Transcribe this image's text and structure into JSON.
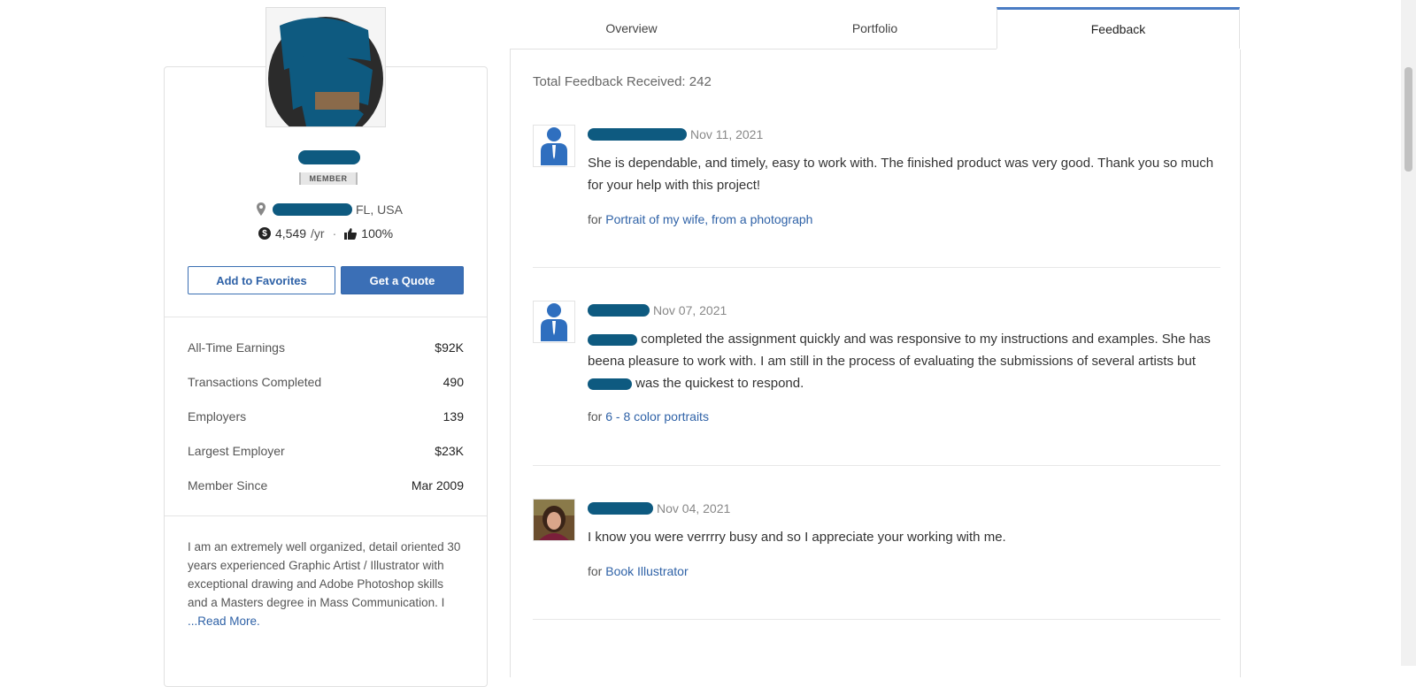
{
  "profile": {
    "badge": "MEMBER",
    "location_suffix": "FL, USA",
    "rate": "4,549",
    "rate_unit": "/yr",
    "approval": "100%",
    "add_favorites": "Add to Favorites",
    "get_quote": "Get a Quote",
    "stats": [
      {
        "label": "All-Time Earnings",
        "value": "$92K"
      },
      {
        "label": "Transactions Completed",
        "value": "490"
      },
      {
        "label": "Employers",
        "value": "139"
      },
      {
        "label": "Largest Employer",
        "value": "$23K"
      },
      {
        "label": "Member Since",
        "value": "Mar 2009"
      }
    ],
    "bio": "I am an extremely well organized, detail oriented 30 years experienced Graphic Artist / Illustrator with exceptional drawing and Adobe Photoshop skills and a Masters degree in Mass Communication. I ",
    "read_more": "...Read More."
  },
  "tabs": {
    "overview": "Overview",
    "portfolio": "Portfolio",
    "feedback": "Feedback"
  },
  "feedback": {
    "total": "Total Feedback Received: 242",
    "for_prefix": "for",
    "items": [
      {
        "date": "Nov 11, 2021",
        "text": "She is dependable, and timely, easy to work with. The finished product was very good. Thank you so much for your help with this project!",
        "project": "Portrait of my wife, from a photograph"
      },
      {
        "date": "Nov 07, 2021",
        "text_a": "completed the assignment quickly and was responsive to my instructions and examples. She has beena pleasure to work with. I am still in the process of evaluating the submissions of several artists but",
        "text_b": "was the quickest to respond.",
        "project": "6 - 8 color portraits"
      },
      {
        "date": "Nov 04, 2021",
        "text": "I know you were verrrry busy and so I appreciate your working with me.",
        "project": "Book Illustrator"
      }
    ]
  }
}
